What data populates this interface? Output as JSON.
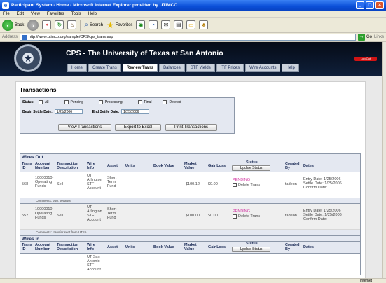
{
  "window": {
    "title": "Participant System - Home - Microsoft Internet Explorer provided by UTIMCO"
  },
  "menu": [
    "File",
    "Edit",
    "View",
    "Favorites",
    "Tools",
    "Help"
  ],
  "toolbar": {
    "back": "Back",
    "search": "Search",
    "favorites": "Favorites"
  },
  "address": {
    "label": "Address",
    "url": "http://www.utimco.org/sample/CPS/cps_trans.asp",
    "go": "Go",
    "links": "Links"
  },
  "site": {
    "title": "CPS - The University of Texas at San Antonio",
    "logout": "Log Out"
  },
  "nav": [
    {
      "label": "Home",
      "active": false
    },
    {
      "label": "Create Trans",
      "active": false
    },
    {
      "label": "Review Trans",
      "active": true
    },
    {
      "label": "Balances",
      "active": false
    },
    {
      "label": "STF Yields",
      "active": false
    },
    {
      "label": "ITF Prices",
      "active": false
    },
    {
      "label": "Wire Accounts",
      "active": false
    },
    {
      "label": "Help",
      "active": false
    }
  ],
  "transactions": {
    "title": "Transactions",
    "status_label": "Status:",
    "statuses": [
      "All",
      "Pending",
      "Processing",
      "Final",
      "Deleted"
    ],
    "begin_label": "Begin Settle Date:",
    "begin_value": "1/25/2006",
    "end_label": "End Settle Date:",
    "end_value": "1/25/2006",
    "buttons": {
      "view": "View Transactions",
      "export": "Export to Excel",
      "print": "Print Transactions"
    }
  },
  "columns": {
    "trans_id": [
      "Trans",
      "ID"
    ],
    "account": [
      "Account",
      "Number"
    ],
    "description": [
      "Transaction",
      "Description"
    ],
    "wire_info": [
      "Wire",
      "Info"
    ],
    "asset": "Asset",
    "units": "Units",
    "book_value": "Book Value",
    "market_value": [
      "Market",
      "Value"
    ],
    "gainloss": "GainLoss",
    "status": "Status",
    "update_status": "Update Status",
    "created_by": [
      "Created",
      "By"
    ],
    "dates": "Dates"
  },
  "wires_out": {
    "title": "Wires Out",
    "rows": [
      {
        "trans_id": "568",
        "account": [
          "10000010-",
          "Operating",
          "Funds"
        ],
        "description": "Sell",
        "wire_info": [
          "UT",
          "Arlington",
          "STF",
          "Account"
        ],
        "asset": [
          "Short",
          "Term",
          "Fund"
        ],
        "market_value": "$100.12",
        "gainloss": "$0.00",
        "status": "PENDING",
        "delete_label": "Delete Trans",
        "created_by": "tadeon",
        "dates": [
          "Entry Date: 1/25/2006",
          "Settle Date: 1/25/2006",
          "Confirm Date:"
        ],
        "comment": "Comments: Just because"
      },
      {
        "trans_id": "552",
        "account": [
          "10000010-",
          "Operating",
          "Funds"
        ],
        "description": "Sell",
        "wire_info": [
          "UT",
          "Arlington",
          "STF",
          "Account"
        ],
        "asset": [
          "Short",
          "Term",
          "Fund"
        ],
        "market_value": "$100.00",
        "gainloss": "$0.00",
        "status": "PENDING",
        "delete_label": "Delete Trans",
        "created_by": "tadeon",
        "dates": [
          "Entry Date: 1/25/2006",
          "Settle Date: 1/25/2006",
          "Confirm Date:"
        ],
        "comment": "Comments: transfer sent from UTSA"
      }
    ]
  },
  "wires_in": {
    "title": "Wires In",
    "wire_info_partial": [
      "UT San",
      "Antonio",
      "STF",
      "Account"
    ]
  },
  "statusbar": {
    "zone": "Internet"
  }
}
